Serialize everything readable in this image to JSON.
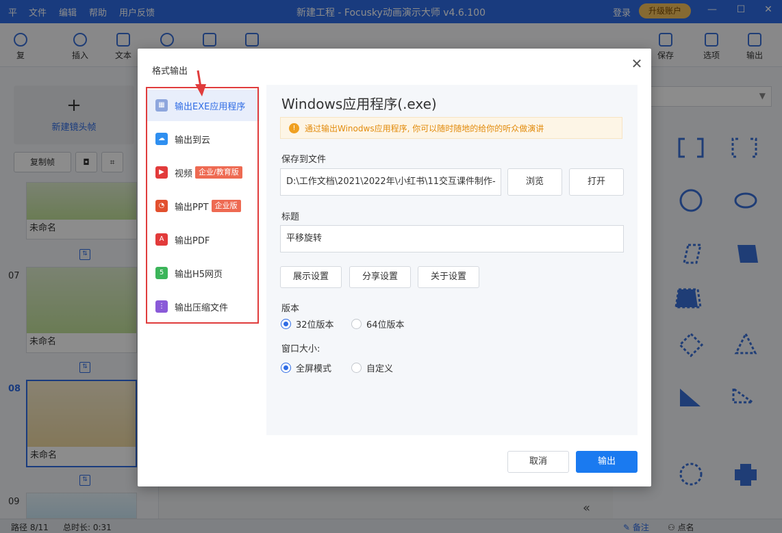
{
  "app": {
    "logo": "平",
    "menu": [
      "文件",
      "编辑",
      "帮助",
      "用户反馈"
    ],
    "title": "新建工程 - Focusky动画演示大师  v4.6.100",
    "login": "登录",
    "upgrade": "升级账户"
  },
  "toolbar": {
    "undo": "复",
    "items": [
      "插入",
      "文本",
      "保存",
      "选项",
      "输出"
    ]
  },
  "left_panel": {
    "new_frame": "新建镜头帧",
    "copy_frame": "复制帧",
    "slides": [
      {
        "num": "",
        "name": "未命名"
      },
      {
        "num": "07",
        "name": "未命名"
      },
      {
        "num": "08",
        "name": "未命名"
      },
      {
        "num": "09",
        "name": ""
      }
    ]
  },
  "status_bar": {
    "path": "路径 8/11",
    "total": "总时长: 0:31",
    "notes": "备注",
    "rollcall": "点名"
  },
  "dialog": {
    "title": "格式输出",
    "menu": [
      {
        "label": "输出EXE应用程序",
        "icon": "windows-icon",
        "color": "#2f6ce5",
        "tag": ""
      },
      {
        "label": "输出到云",
        "icon": "cloud-icon",
        "color": "#2f8ff0",
        "tag": ""
      },
      {
        "label": "视频",
        "icon": "video-icon",
        "color": "#e23b3b",
        "tag": "企业/教育版"
      },
      {
        "label": "输出PPT",
        "icon": "ppt-icon",
        "color": "#e2502e",
        "tag": "企业版"
      },
      {
        "label": "输出PDF",
        "icon": "pdf-icon",
        "color": "#e23b3b",
        "tag": ""
      },
      {
        "label": "输出H5网页",
        "icon": "html5-icon",
        "color": "#3cb55a",
        "tag": ""
      },
      {
        "label": "输出压缩文件",
        "icon": "zip-icon",
        "color": "#8a5ad8",
        "tag": ""
      }
    ],
    "content": {
      "heading": "Windows应用程序(.exe)",
      "notice": "通过输出Winodws应用程序, 你可以随时随地的给你的听众做演讲",
      "save_label": "保存到文件",
      "path_value": "D:\\工作文档\\2021\\2022年\\小红书\\11交互课件制作-",
      "browse": "浏览",
      "open": "打开",
      "title_label": "标题",
      "title_value": "平移旋转",
      "btn_display": "展示设置",
      "btn_share": "分享设置",
      "btn_about": "关于设置",
      "version_label": "版本",
      "version_32": "32位版本",
      "version_64": "64位版本",
      "window_label": "窗口大小:",
      "fullscreen": "全屏模式",
      "custom": "自定义"
    },
    "cancel": "取消",
    "export": "输出"
  }
}
